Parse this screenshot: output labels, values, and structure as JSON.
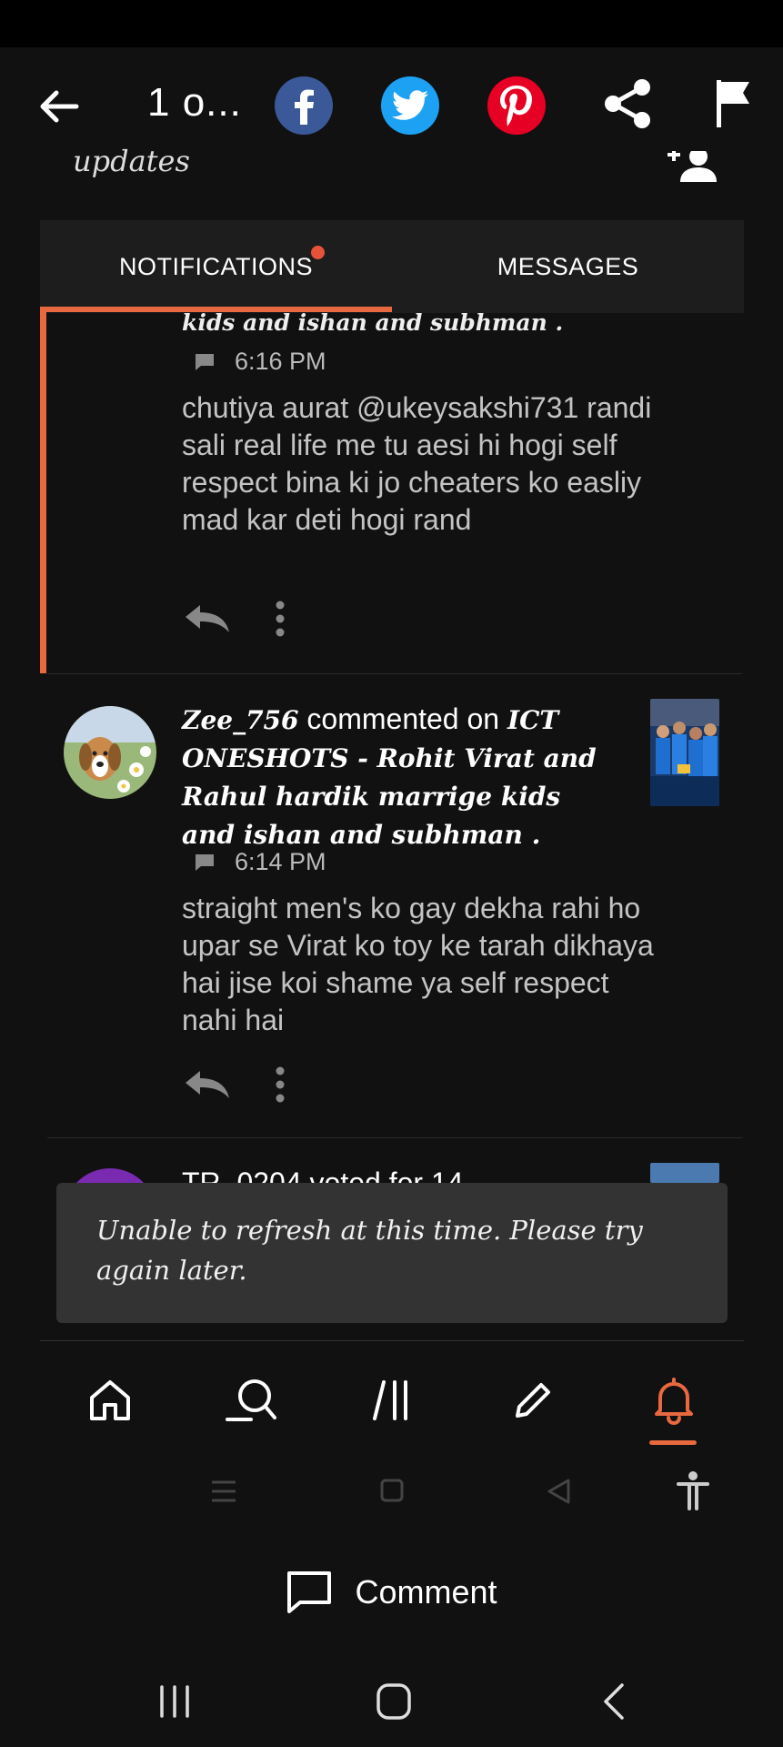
{
  "header": {
    "title": "1 o...",
    "cut_section_label": "updates"
  },
  "tabs": [
    {
      "label": "NOTIFICATIONS",
      "has_dot": true
    },
    {
      "label": "MESSAGES"
    }
  ],
  "item1": {
    "story_tail": "kids and ishan and subhman .",
    "time": "6:16 PM",
    "comment": "chutiya aurat @ukeysakshi731 randi sali real life me tu aesi hi hogi self respect bina ki jo cheaters ko easliy mad kar deti hogi rand"
  },
  "item2": {
    "user": "Zee_756",
    "verb": " commented on ",
    "story": "ICT ONESHOTS - Rohit Virat and Rahul hardik marrige kids and ishan and subhman .",
    "time": "6:14 PM",
    "comment": "straight men's ko gay dekha rahi ho upar se Virat ko toy ke tarah dikhaya hai jise koi shame ya self respect nahi hai"
  },
  "item3": {
    "partial_text": "TR_0204 voted for 14"
  },
  "toast": {
    "message": "Unable to refresh at this time.  Please try again later."
  },
  "bottom_bar": {
    "comment_label": "Comment"
  },
  "colors": {
    "accent": "#e8683f",
    "facebook": "#3b5998",
    "twitter": "#1da1f2",
    "pinterest": "#e60023"
  }
}
